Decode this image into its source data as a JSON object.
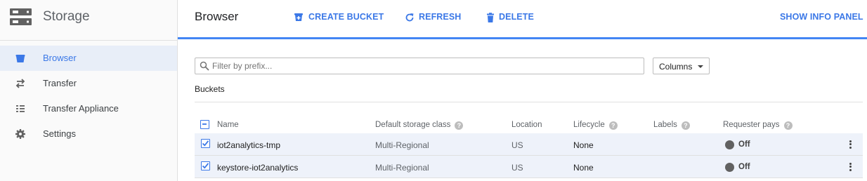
{
  "sidebar": {
    "title": "Storage",
    "items": [
      {
        "label": "Browser",
        "icon": "bucket-icon",
        "active": true
      },
      {
        "label": "Transfer",
        "icon": "transfer-arrows-icon",
        "active": false
      },
      {
        "label": "Transfer Appliance",
        "icon": "list-icon",
        "active": false
      },
      {
        "label": "Settings",
        "icon": "gear-icon",
        "active": false
      }
    ]
  },
  "header": {
    "title": "Browser",
    "create_bucket": "CREATE BUCKET",
    "refresh": "REFRESH",
    "delete": "DELETE",
    "show_info_panel": "SHOW INFO PANEL"
  },
  "filter": {
    "placeholder": "Filter by prefix...",
    "value": ""
  },
  "columns_button": "Columns",
  "section_label": "Buckets",
  "table": {
    "columns": [
      "Name",
      "Default storage class",
      "Location",
      "Lifecycle",
      "Labels",
      "Requester pays"
    ],
    "rows": [
      {
        "name": "iot2analytics-tmp",
        "storage_class": "Multi-Regional",
        "location": "US",
        "lifecycle": "None",
        "labels": "",
        "requester_pays": "Off",
        "selected": true
      },
      {
        "name": "keystore-iot2analytics",
        "storage_class": "Multi-Regional",
        "location": "US",
        "lifecycle": "None",
        "labels": "",
        "requester_pays": "Off",
        "selected": true
      }
    ]
  },
  "colors": {
    "accent": "#3b78e7",
    "active_bg": "#e8eef8",
    "row_selected_bg": "#eef2fa"
  }
}
